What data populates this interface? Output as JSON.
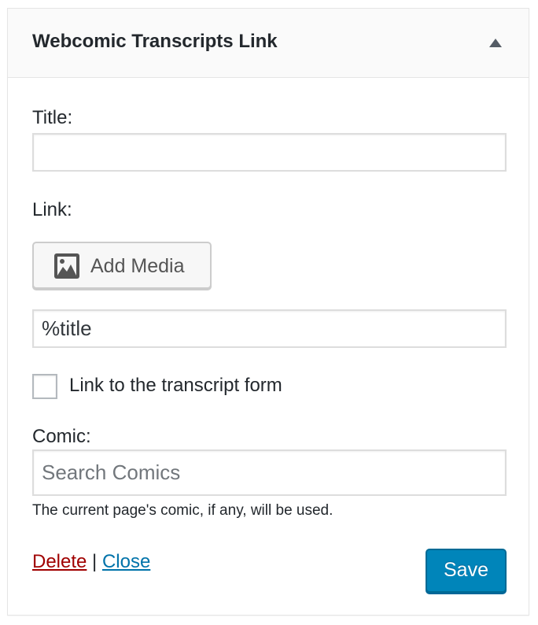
{
  "widget": {
    "title": "Webcomic Transcripts Link"
  },
  "fields": {
    "title_label": "Title:",
    "title_value": "",
    "link_label": "Link:",
    "add_media_label": "Add Media",
    "link_value": "%title",
    "transcript_checkbox_label": "Link to the transcript form",
    "transcript_checked": false,
    "comic_label": "Comic:",
    "comic_placeholder": "Search Comics",
    "comic_description": "The current page's comic, if any, will be used."
  },
  "controls": {
    "delete_label": "Delete",
    "separator": "|",
    "close_label": "Close",
    "save_label": "Save"
  },
  "icons": {
    "toggle": "triangle-up-icon",
    "media": "media-image-icon"
  },
  "colors": {
    "primary_button": "#0085ba",
    "delete_link": "#a00000",
    "close_link": "#0073aa"
  }
}
